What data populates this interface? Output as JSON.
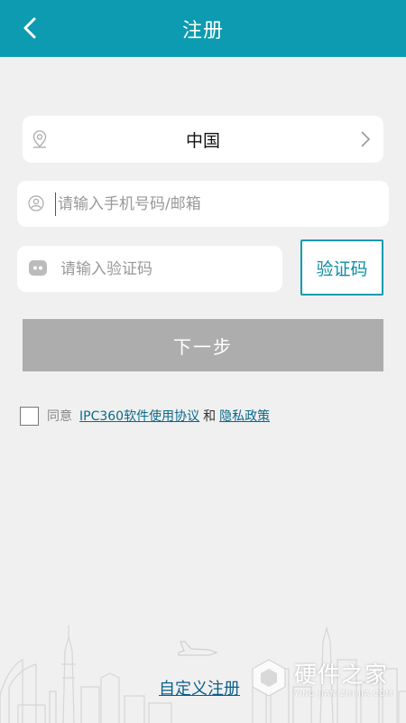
{
  "header": {
    "title": "注册",
    "back_icon": "chevron-left-icon"
  },
  "country": {
    "value": "中国",
    "icon": "location-pin-icon",
    "chevron_icon": "chevron-right-icon"
  },
  "phone": {
    "placeholder": "请输入手机号码/邮箱",
    "value": "",
    "icon": "user-icon"
  },
  "code": {
    "placeholder": "请输入验证码",
    "value": "",
    "icon": "message-icon"
  },
  "verify_button": {
    "label": "验证码"
  },
  "next_button": {
    "label": "下一步"
  },
  "agreement": {
    "prefix": "同意",
    "terms_link": "IPC360软件使用协议",
    "and": "和",
    "privacy_link": "隐私政策",
    "checked": false
  },
  "custom_register": {
    "label": "自定义注册"
  },
  "watermark": {
    "main": "硬件之家",
    "sub": "YING JIAN ZHI JIA.COM"
  },
  "colors": {
    "accent": "#0c9bb0",
    "background": "#f0f0f0",
    "disabled_button": "#adadad",
    "link": "#0a6a8a"
  }
}
